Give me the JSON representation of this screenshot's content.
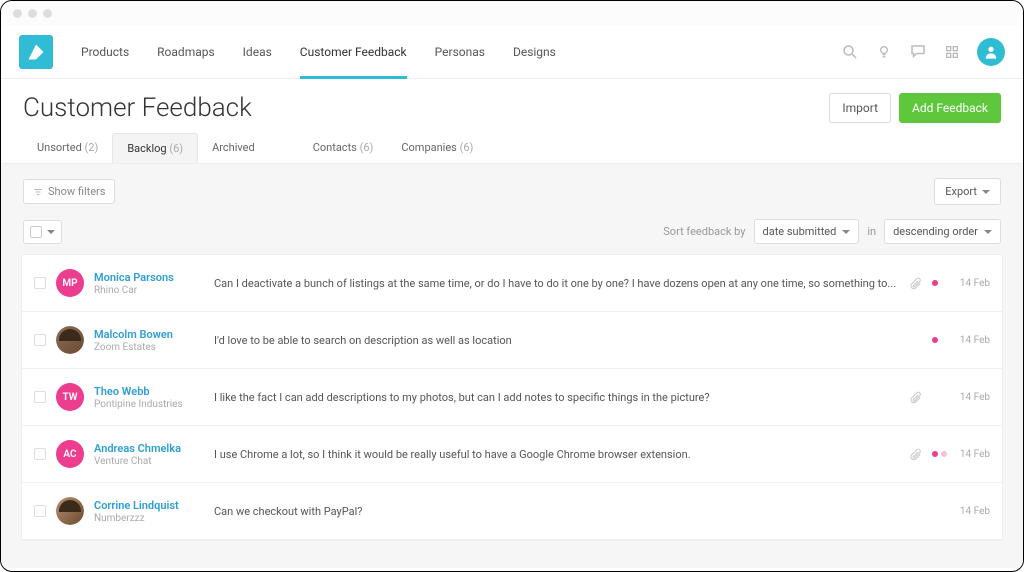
{
  "nav": {
    "tabs": [
      "Products",
      "Roadmaps",
      "Ideas",
      "Customer Feedback",
      "Personas",
      "Designs"
    ],
    "active_index": 3
  },
  "page": {
    "title": "Customer Feedback",
    "import_label": "Import",
    "add_label": "Add Feedback"
  },
  "sub_tabs": [
    {
      "label": "Unsorted",
      "count": "(2)"
    },
    {
      "label": "Backlog",
      "count": "(6)"
    },
    {
      "label": "Archived",
      "count": ""
    },
    {
      "gap": true
    },
    {
      "label": "Contacts",
      "count": "(6)"
    },
    {
      "label": "Companies",
      "count": "(6)"
    }
  ],
  "sub_active_index": 1,
  "toolbar": {
    "show_filters": "Show filters",
    "export": "Export"
  },
  "sort": {
    "prefix": "Sort feedback by",
    "field": "date submitted",
    "middle": "in",
    "direction": "descending order"
  },
  "feedback": [
    {
      "initials": "MP",
      "avatar_type": "initials",
      "avatar_bg": "#ec3d8e",
      "name": "Monica Parsons",
      "company": "Rhino Car",
      "message": "Can I deactivate a bunch of listings at the same time, or do I have to do it one by one? I have dozens open at any one time, so something to...",
      "attach": true,
      "dots": [
        "pink"
      ],
      "date": "14 Feb"
    },
    {
      "initials": "",
      "avatar_type": "photo",
      "avatar_bg": "#8a6d5a",
      "name": "Malcolm Bowen",
      "company": "Zoom Estates",
      "message": "I'd love to be able to search on description as well as location",
      "attach": false,
      "dots": [
        "pink"
      ],
      "date": "14 Feb"
    },
    {
      "initials": "TW",
      "avatar_type": "initials",
      "avatar_bg": "#ec3d8e",
      "name": "Theo Webb",
      "company": "Pontipine Industries",
      "message": "I like the fact I can add descriptions to my photos, but can I add notes to specific things in the picture?",
      "attach": true,
      "dots": [],
      "date": "14 Feb"
    },
    {
      "initials": "AC",
      "avatar_type": "initials",
      "avatar_bg": "#ec3d8e",
      "name": "Andreas Chmelka",
      "company": "Venture Chat",
      "message": "I use Chrome a lot, so I think it would be really useful to have a Google Chrome browser extension.",
      "attach": true,
      "dots": [
        "pink",
        "pink-light"
      ],
      "date": "14 Feb"
    },
    {
      "initials": "",
      "avatar_type": "photo",
      "avatar_bg": "#b89070",
      "name": "Corrine Lindquist",
      "company": "Numberzzz",
      "message": "Can we checkout with PayPal?",
      "attach": false,
      "dots": [],
      "date": "14 Feb"
    }
  ]
}
